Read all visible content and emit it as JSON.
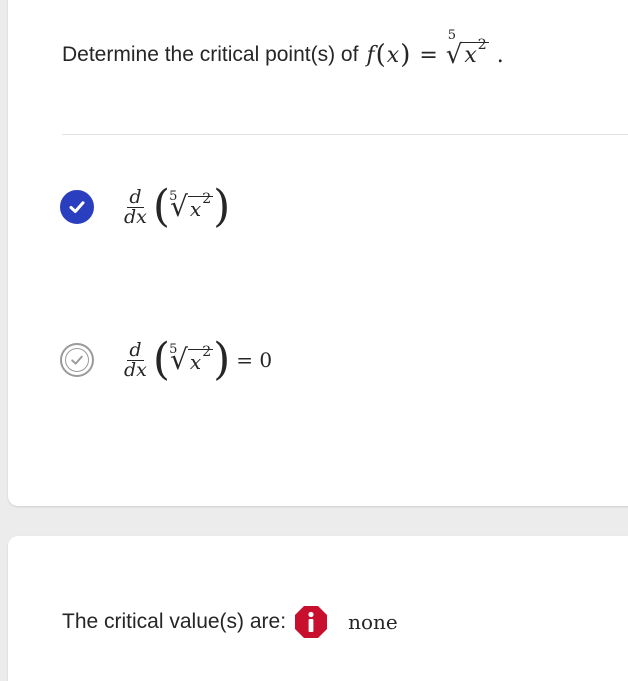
{
  "question": {
    "prompt": "Determine the critical point(s) of",
    "function_name": "f",
    "variable": "x",
    "equals": "=",
    "root_index": "5",
    "radicand_base": "x",
    "radicand_exponent": "2",
    "period": "."
  },
  "options": [
    {
      "state": "checked",
      "derivative_num": "d",
      "derivative_den": "dx",
      "root_index": "5",
      "radicand_base": "x",
      "radicand_exponent": "2",
      "suffix": ""
    },
    {
      "state": "unchecked",
      "derivative_num": "d",
      "derivative_den": "dx",
      "root_index": "5",
      "radicand_base": "x",
      "radicand_exponent": "2",
      "suffix": "= 0"
    }
  ],
  "answer": {
    "label": "The critical value(s) are:",
    "value": "none",
    "info_icon": "info-icon"
  },
  "colors": {
    "checked_accent": "#2a3fbf",
    "info_accent": "#c8102e",
    "unchecked_gray": "#9a9a9a"
  }
}
